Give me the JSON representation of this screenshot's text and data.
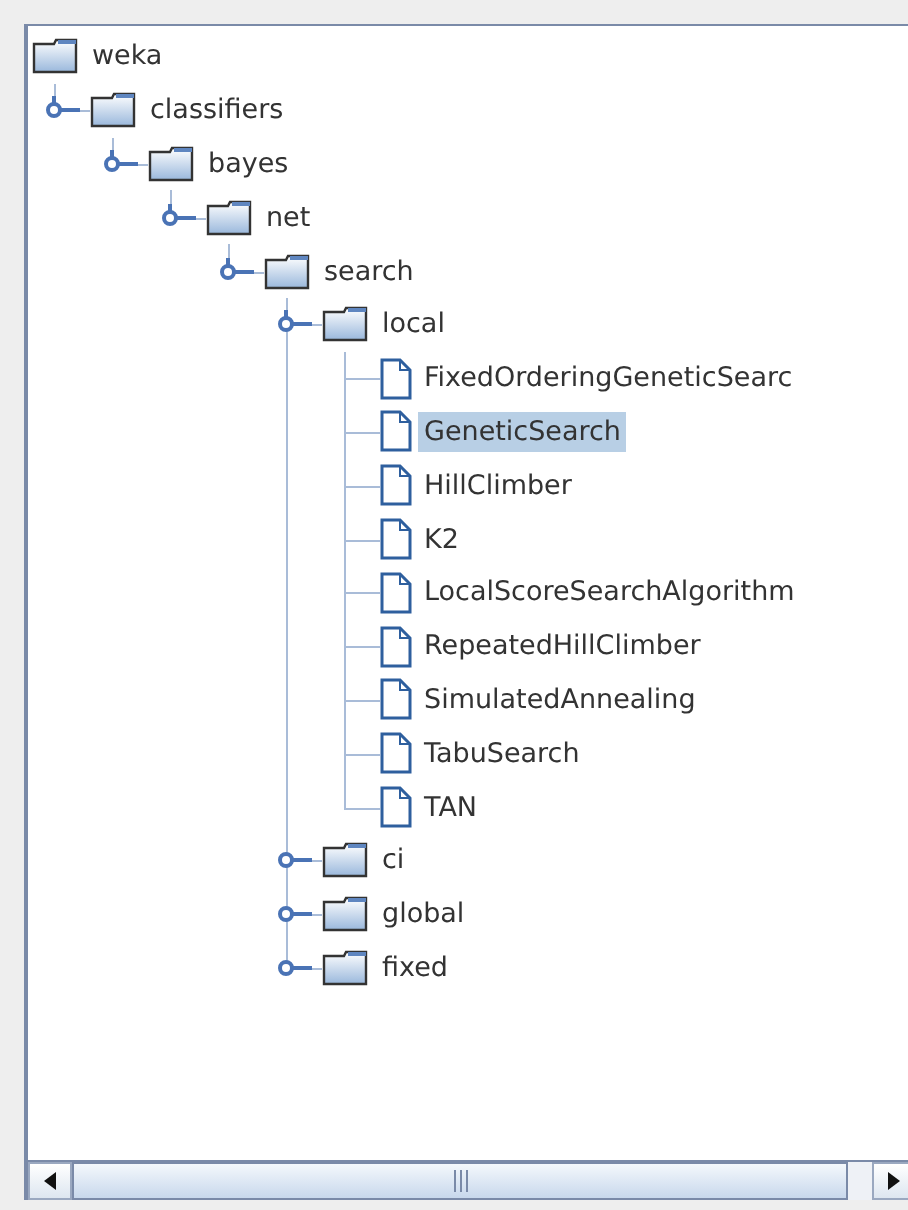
{
  "tree": {
    "label": "weka",
    "kind": "folder",
    "selected": false,
    "children": [
      {
        "label": "classifiers",
        "kind": "folder",
        "expanded": true,
        "selected": false,
        "children": [
          {
            "label": "bayes",
            "kind": "folder",
            "expanded": true,
            "selected": false,
            "children": [
              {
                "label": "net",
                "kind": "folder",
                "expanded": true,
                "selected": false,
                "children": [
                  {
                    "label": "search",
                    "kind": "folder",
                    "expanded": true,
                    "selected": false,
                    "children": [
                      {
                        "label": "local",
                        "kind": "folder",
                        "expanded": true,
                        "selected": false,
                        "children": [
                          {
                            "label": "FixedOrderingGeneticSearc",
                            "kind": "file",
                            "selected": false
                          },
                          {
                            "label": "GeneticSearch",
                            "kind": "file",
                            "selected": true
                          },
                          {
                            "label": "HillClimber",
                            "kind": "file",
                            "selected": false
                          },
                          {
                            "label": "K2",
                            "kind": "file",
                            "selected": false
                          },
                          {
                            "label": "LocalScoreSearchAlgorithm",
                            "kind": "file",
                            "selected": false
                          },
                          {
                            "label": "RepeatedHillClimber",
                            "kind": "file",
                            "selected": false
                          },
                          {
                            "label": "SimulatedAnnealing",
                            "kind": "file",
                            "selected": false
                          },
                          {
                            "label": "TabuSearch",
                            "kind": "file",
                            "selected": false
                          },
                          {
                            "label": "TAN",
                            "kind": "file",
                            "selected": false
                          }
                        ]
                      },
                      {
                        "label": "ci",
                        "kind": "folder",
                        "expanded": false,
                        "selected": false
                      },
                      {
                        "label": "global",
                        "kind": "folder",
                        "expanded": false,
                        "selected": false
                      },
                      {
                        "label": "fixed",
                        "kind": "folder",
                        "expanded": false,
                        "selected": false
                      }
                    ]
                  }
                ]
              }
            ]
          }
        ]
      }
    ]
  }
}
